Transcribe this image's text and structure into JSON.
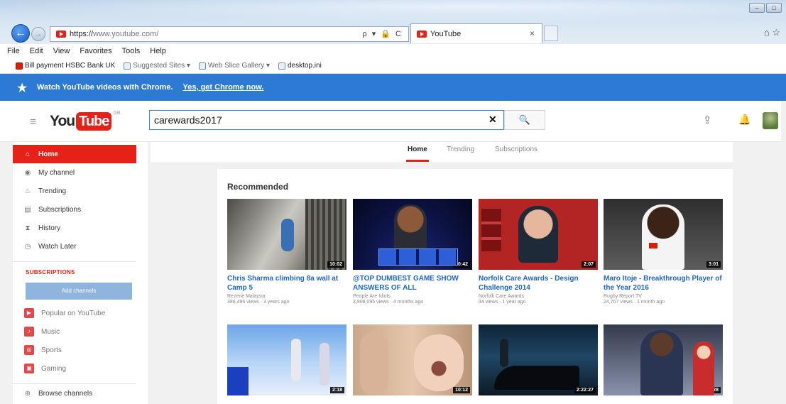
{
  "browser": {
    "address_scheme": "https://",
    "address_host": "www.youtube.com/",
    "address_tools": "ρ ▾ 🔒 C",
    "tab_title": "YouTube",
    "tab_close": "×",
    "menu": [
      "File",
      "Edit",
      "View",
      "Favorites",
      "Tools",
      "Help"
    ],
    "favorites": [
      {
        "label": "Bill payment HSBC Bank UK",
        "muted": false
      },
      {
        "label": "Suggested Sites ▾",
        "muted": true
      },
      {
        "label": "Web Slice Gallery ▾",
        "muted": true
      },
      {
        "label": "desktop.ini",
        "muted": false
      }
    ]
  },
  "promo": {
    "text": "Watch YouTube videos with Chrome.",
    "link": "Yes, get Chrome now."
  },
  "masthead": {
    "logo_you": "You",
    "logo_tube": "Tube",
    "logo_region": "GB",
    "search_value": "carewards2017",
    "search_clear": "✕",
    "search_icon": "🔍"
  },
  "guide": {
    "items": [
      {
        "label": "Home",
        "icon": "⌂",
        "active": true
      },
      {
        "label": "My channel",
        "icon": "◉"
      },
      {
        "label": "Trending",
        "icon": "♨"
      },
      {
        "label": "Subscriptions",
        "icon": "▤"
      },
      {
        "label": "History",
        "icon": "⧗"
      },
      {
        "label": "Watch Later",
        "icon": "◷"
      }
    ],
    "subscriptions_heading": "SUBSCRIPTIONS",
    "add_channels_label": "Add channels",
    "subscriptions": [
      {
        "label": "Popular on YouTube",
        "icon": "▶"
      },
      {
        "label": "Music",
        "icon": "♪"
      },
      {
        "label": "Sports",
        "icon": "◎"
      },
      {
        "label": "Gaming",
        "icon": "▣"
      }
    ],
    "browse_channels": "Browse channels"
  },
  "feed_tabs": [
    "Home",
    "Trending",
    "Subscriptions"
  ],
  "shelf": {
    "title": "Recommended",
    "videos": [
      {
        "title": "Chris Sharma climbing 8a wall at Camp 5",
        "channel": "Rezerie Malaysia",
        "meta": "386,496 views · 3 years ago",
        "duration": "10:02"
      },
      {
        "title": "@TOP DUMBEST GAME SHOW ANSWERS OF ALL",
        "channel": "People Are Idiots",
        "meta": "3,908,095 views · 4 months ago",
        "duration": "10:42"
      },
      {
        "title": "Norfolk Care Awards - Design Challenge 2014",
        "channel": "Norfolk Care Awards",
        "meta": "34 views · 1 year ago",
        "duration": "2:07"
      },
      {
        "title": "Maro Itoje - Breakthrough Player of the Year 2016",
        "channel": "Rugby Report TV",
        "meta": "24,767 views · 1 month ago",
        "duration": "3:01"
      },
      {
        "title": "",
        "channel": "",
        "meta": "",
        "duration": "2:18"
      },
      {
        "title": "",
        "channel": "",
        "meta": "",
        "duration": "10:12"
      },
      {
        "title": "",
        "channel": "",
        "meta": "",
        "duration": "2:22:27"
      },
      {
        "title": "",
        "channel": "",
        "meta": "",
        "duration": "6:28"
      }
    ]
  },
  "colors": {
    "brand_red": "#e62117",
    "link_blue": "#1a68c8",
    "promo_blue": "#2d7ad5"
  }
}
